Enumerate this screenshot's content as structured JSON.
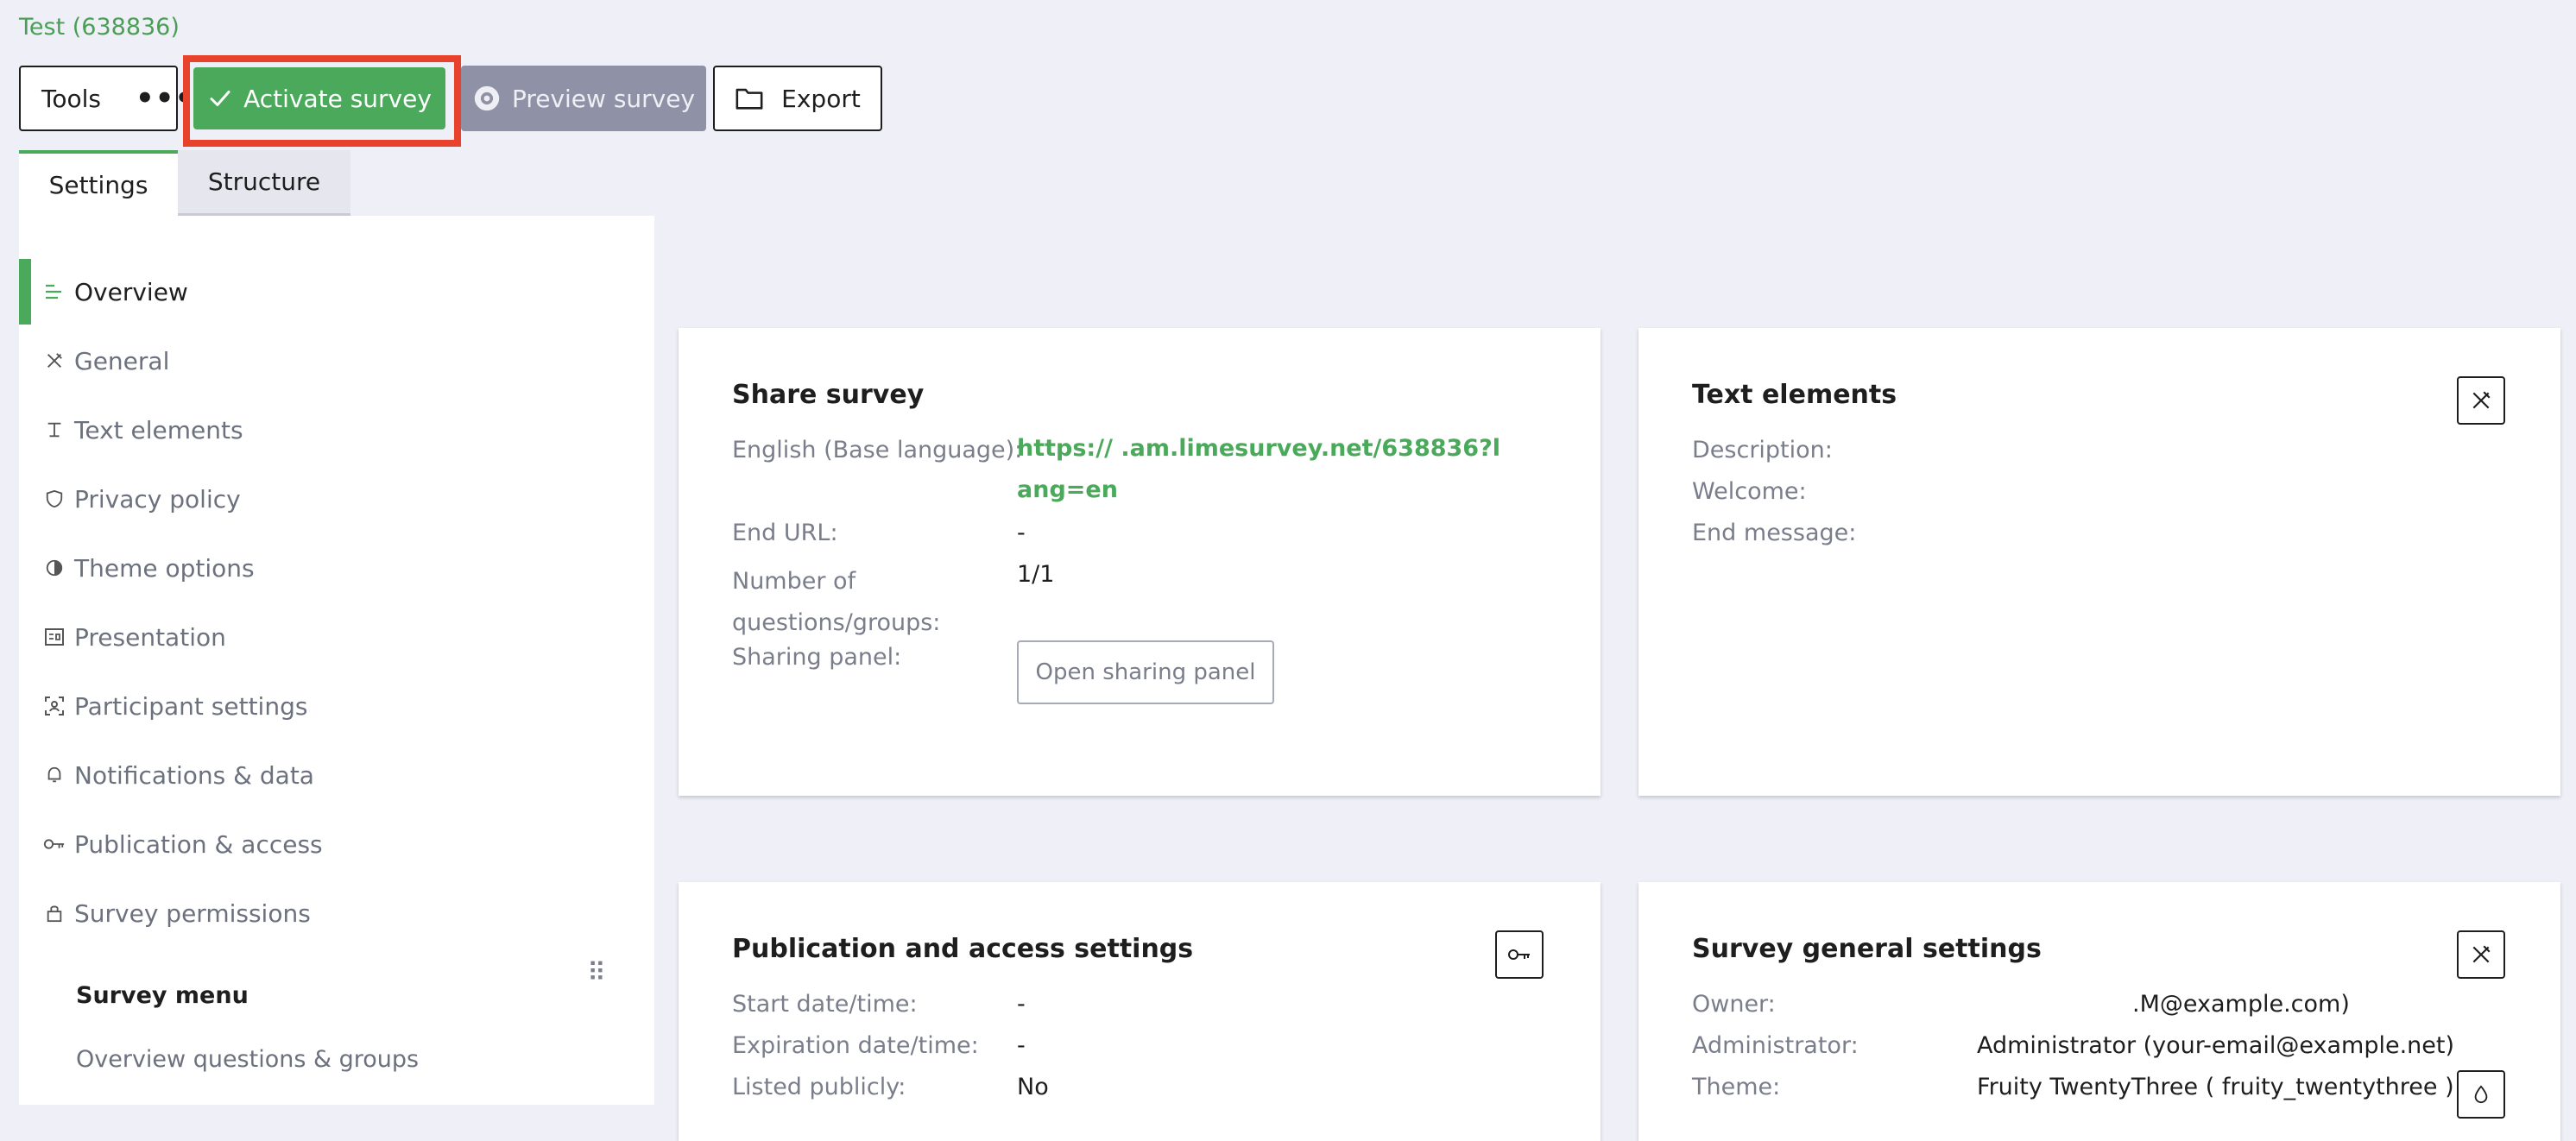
{
  "breadcrumb": "Test (638836)",
  "toolbar": {
    "tools_label": "Tools",
    "more_label": "•••",
    "activate_label": "Activate survey",
    "preview_label": "Preview survey",
    "export_label": "Export"
  },
  "tabs": {
    "settings": "Settings",
    "structure": "Structure"
  },
  "sidebar": {
    "items": [
      {
        "label": "Overview",
        "icon": "overview-icon"
      },
      {
        "label": "General",
        "icon": "tools-icon"
      },
      {
        "label": "Text elements",
        "icon": "text-icon"
      },
      {
        "label": "Privacy policy",
        "icon": "shield-icon"
      },
      {
        "label": "Theme options",
        "icon": "contrast-icon"
      },
      {
        "label": "Presentation",
        "icon": "presentation-icon"
      },
      {
        "label": "Participant settings",
        "icon": "participant-icon"
      },
      {
        "label": "Notifications & data",
        "icon": "bell-icon"
      },
      {
        "label": "Publication & access",
        "icon": "key-icon"
      },
      {
        "label": "Survey permissions",
        "icon": "lock-icon"
      }
    ],
    "survey_menu_title": "Survey menu",
    "overview_questions": "Overview questions & groups"
  },
  "share_card": {
    "title": "Share survey",
    "language_label": "English (Base language):",
    "url": "https://     .am.limesurvey.net/638836?lang=en",
    "end_url_label": "End URL:",
    "end_url_value": "-",
    "num_label": "Number of questions/groups:",
    "num_value": "1/1",
    "sharing_label": "Sharing panel:",
    "open_panel_label": "Open sharing panel"
  },
  "text_card": {
    "title": "Text elements",
    "description_label": "Description:",
    "welcome_label": "Welcome:",
    "end_message_label": "End message:"
  },
  "publication_card": {
    "title": "Publication and access settings",
    "start_label": "Start date/time:",
    "start_value": "-",
    "expiration_label": "Expiration date/time:",
    "expiration_value": "-",
    "listed_label": "Listed publicly:",
    "listed_value": "No"
  },
  "general_card": {
    "title": "Survey general settings",
    "owner_label": "Owner:",
    "owner_value": ".M@example.com)",
    "admin_label": "Administrator:",
    "admin_value": "Administrator (your-email@example.net)",
    "theme_label": "Theme:",
    "theme_value": "Fruity TwentyThree ( fruity_twentythree )"
  },
  "colors": {
    "accent": "#4aa95a",
    "highlight": "#e8412c",
    "preview": "#8f91a6",
    "background": "#eeeff7"
  }
}
